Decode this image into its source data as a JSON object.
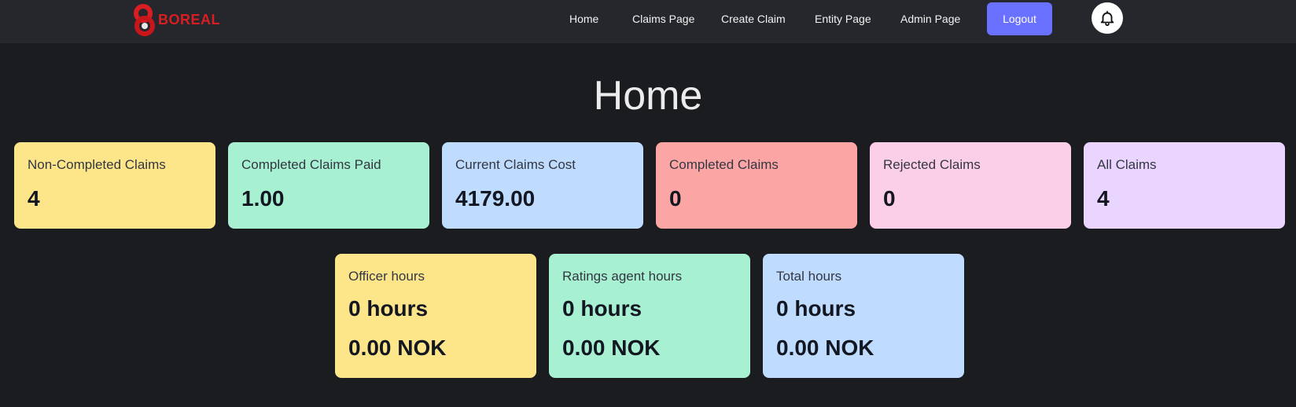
{
  "brand": {
    "name": "BOREAL",
    "logo_icon": "boreal-logo-icon",
    "color": "#d81e23"
  },
  "nav": {
    "links": [
      {
        "label": "Home"
      },
      {
        "label": "Claims Page"
      },
      {
        "label": "Create Claim"
      },
      {
        "label": "Entity Page"
      },
      {
        "label": "Admin Page"
      }
    ],
    "logout_label": "Logout",
    "notification_icon": "bell-icon",
    "accent_color": "#6a70ff"
  },
  "page": {
    "title": "Home"
  },
  "stats": [
    {
      "label": "Non-Completed Claims",
      "value": "4",
      "color": "#fde58a"
    },
    {
      "label": "Completed Claims Paid",
      "value": "1.00",
      "color": "#a7f0d1"
    },
    {
      "label": "Current Claims Cost",
      "value": "4179.00",
      "color": "#bfdbfe"
    },
    {
      "label": "Completed Claims",
      "value": "0",
      "color": "#fca5a5"
    },
    {
      "label": "Rejected Claims",
      "value": "0",
      "color": "#fbcfe8"
    },
    {
      "label": "All Claims",
      "value": "4",
      "color": "#e9d5ff"
    }
  ],
  "hours": [
    {
      "label": "Officer hours",
      "hours": "0 hours",
      "cost": "0.00 NOK",
      "color": "#fde58a"
    },
    {
      "label": "Ratings agent hours",
      "hours": "0 hours",
      "cost": "0.00 NOK",
      "color": "#a7f0d1"
    },
    {
      "label": "Total hours",
      "hours": "0 hours",
      "cost": "0.00 NOK",
      "color": "#bfdbfe"
    }
  ]
}
